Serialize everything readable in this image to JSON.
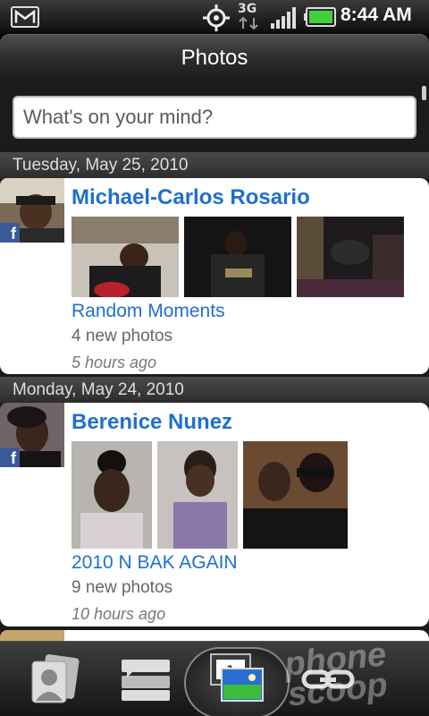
{
  "status_bar": {
    "time": "8:44 AM",
    "network": "3G",
    "icons": [
      "gmail-icon",
      "gps-icon",
      "signal-icon",
      "battery-icon"
    ]
  },
  "header": {
    "title": "Photos"
  },
  "status_input": {
    "placeholder": "What's on your mind?"
  },
  "feed": [
    {
      "date": "Tuesday, May 25, 2010",
      "name": "Michael-Carlos Rosario",
      "album": "Random Moments",
      "count": "4 new photos",
      "time": "5 hours ago",
      "source": "Facebook",
      "badge": "f"
    },
    {
      "date": "Monday, May 24, 2010",
      "name": "Berenice Nunez",
      "album": "2010 N BAK AGAIN",
      "count": "9 new photos",
      "time": "10 hours ago",
      "source": "Facebook",
      "badge": "f"
    }
  ],
  "tabs": [
    {
      "name": "people",
      "icon": "contacts-icon",
      "active": false
    },
    {
      "name": "updates",
      "icon": "updates-icon",
      "active": false
    },
    {
      "name": "photos",
      "icon": "photos-icon",
      "active": true
    },
    {
      "name": "links",
      "icon": "link-icon",
      "active": false
    }
  ],
  "watermark": {
    "line1": "phone",
    "line2": "scoop"
  },
  "colors": {
    "accent_blue": "#1f6fd0",
    "facebook_blue": "#3b5998",
    "card_bg": "#ffffff",
    "header_gray": "#2b2b2b"
  }
}
